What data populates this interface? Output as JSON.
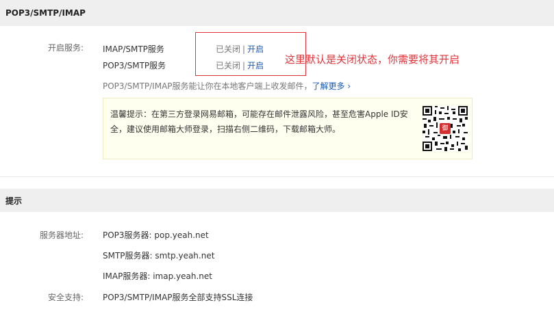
{
  "section1": {
    "title": "POP3/SMTP/IMAP",
    "service_label": "开启服务:",
    "services": [
      {
        "name": "IMAP/SMTP服务",
        "status": "已关闭",
        "separator": "|",
        "action": "开启"
      },
      {
        "name": "POP3/SMTP服务",
        "status": "已关闭",
        "separator": "|",
        "action": "开启"
      }
    ],
    "desc": "POP3/SMTP/IMAP服务能让你在本地客户端上收发邮件，",
    "learn_more": "了解更多 ›",
    "annotation": "这里默认是关闭状态，你需要将其开启",
    "tip": "温馨提示：在第三方登录网易邮箱，可能存在邮件泄露风险，甚至危害Apple ID安全，建议使用邮箱大师登录，扫描右侧二维码，下载邮箱大师。",
    "qr_badge": "御",
    "accent_color": "#e0343a",
    "link_color": "#1a5bb5"
  },
  "section2": {
    "title": "提示",
    "server_label": "服务器地址:",
    "servers": [
      "POP3服务器: pop.yeah.net",
      "SMTP服务器: smtp.yeah.net",
      "IMAP服务器: imap.yeah.net"
    ],
    "security_label": "安全支持:",
    "security_text": "POP3/SMTP/IMAP服务全部支持SSL连接"
  },
  "icons": {
    "qr": "qr-code-icon"
  }
}
